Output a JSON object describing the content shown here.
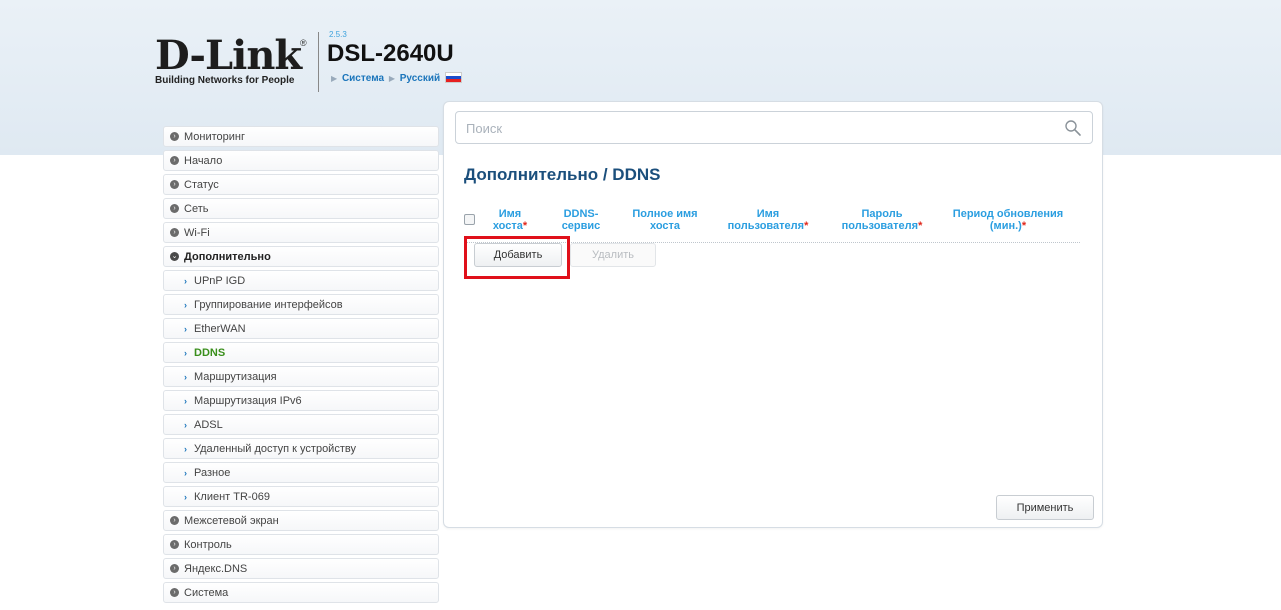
{
  "header": {
    "logo_text": "D-Link",
    "logo_registered": "®",
    "logo_tagline": "Building Networks for People",
    "fw_version": "2.5.3",
    "model": "DSL-2640U",
    "nav": [
      "Система",
      "Русский"
    ],
    "language_flag": "russian-flag-icon"
  },
  "search": {
    "placeholder": "Поиск",
    "value": ""
  },
  "page": {
    "title": "Дополнительно /  DDNS"
  },
  "sidebar": {
    "items": [
      {
        "label": "Мониторинг"
      },
      {
        "label": "Начало"
      },
      {
        "label": "Статус"
      },
      {
        "label": "Сеть"
      },
      {
        "label": "Wi-Fi"
      },
      {
        "label": "Дополнительно"
      },
      {
        "label": "UPnP IGD"
      },
      {
        "label": "Группирование интерфейсов"
      },
      {
        "label": "EtherWAN"
      },
      {
        "label": "DDNS"
      },
      {
        "label": "Маршрутизация"
      },
      {
        "label": "Маршрутизация IPv6"
      },
      {
        "label": "ADSL"
      },
      {
        "label": "Удаленный доступ к устройству"
      },
      {
        "label": "Разное"
      },
      {
        "label": "Клиент TR-069"
      },
      {
        "label": "Межсетевой экран"
      },
      {
        "label": "Контроль"
      },
      {
        "label": "Яндекс.DNS"
      },
      {
        "label": "Система"
      }
    ]
  },
  "table": {
    "columns": [
      {
        "line1": "Имя",
        "line2": "хоста",
        "required": "*"
      },
      {
        "line1": "DDNS-",
        "line2": "сервис",
        "required": ""
      },
      {
        "line1": "Полное имя",
        "line2": "хоста",
        "required": ""
      },
      {
        "line1": "Имя",
        "line2": "пользователя",
        "required": "*"
      },
      {
        "line1": "Пароль",
        "line2": "пользователя",
        "required": "*"
      },
      {
        "line1": "Период обновления",
        "line2": "(мин.)",
        "required": "*"
      }
    ],
    "rows": []
  },
  "buttons": {
    "add": "Добавить",
    "delete": "Удалить",
    "apply": "Применить"
  },
  "colors": {
    "accent": "#2b9ee0",
    "title": "#1b4f7c",
    "active_menu": "#3a8f1c",
    "highlight": "#e0101a"
  }
}
